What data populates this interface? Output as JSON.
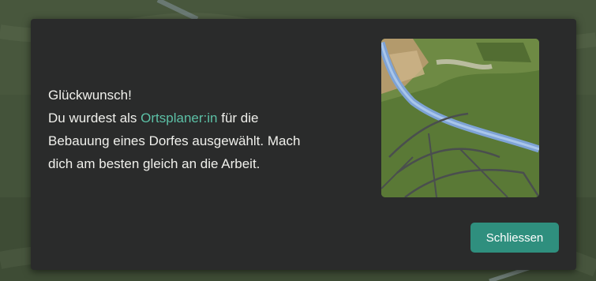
{
  "dialog": {
    "heading": "Glückwunsch!",
    "line1_prefix": "Du wurdest als ",
    "role_highlight": "Ortsplaner:in",
    "line1_suffix": " für die",
    "line2": "Bebauung eines Dorfes ausgewählt. Mach",
    "line3": "dich am besten gleich an die Arbeit.",
    "close_label": "Schliessen",
    "preview_icon": "village-terrain-preview"
  },
  "colors": {
    "dialog_bg": "#2a2b2b",
    "text": "#f0f0ec",
    "highlight": "#5cc0a6",
    "button": "#2f8f7e"
  }
}
